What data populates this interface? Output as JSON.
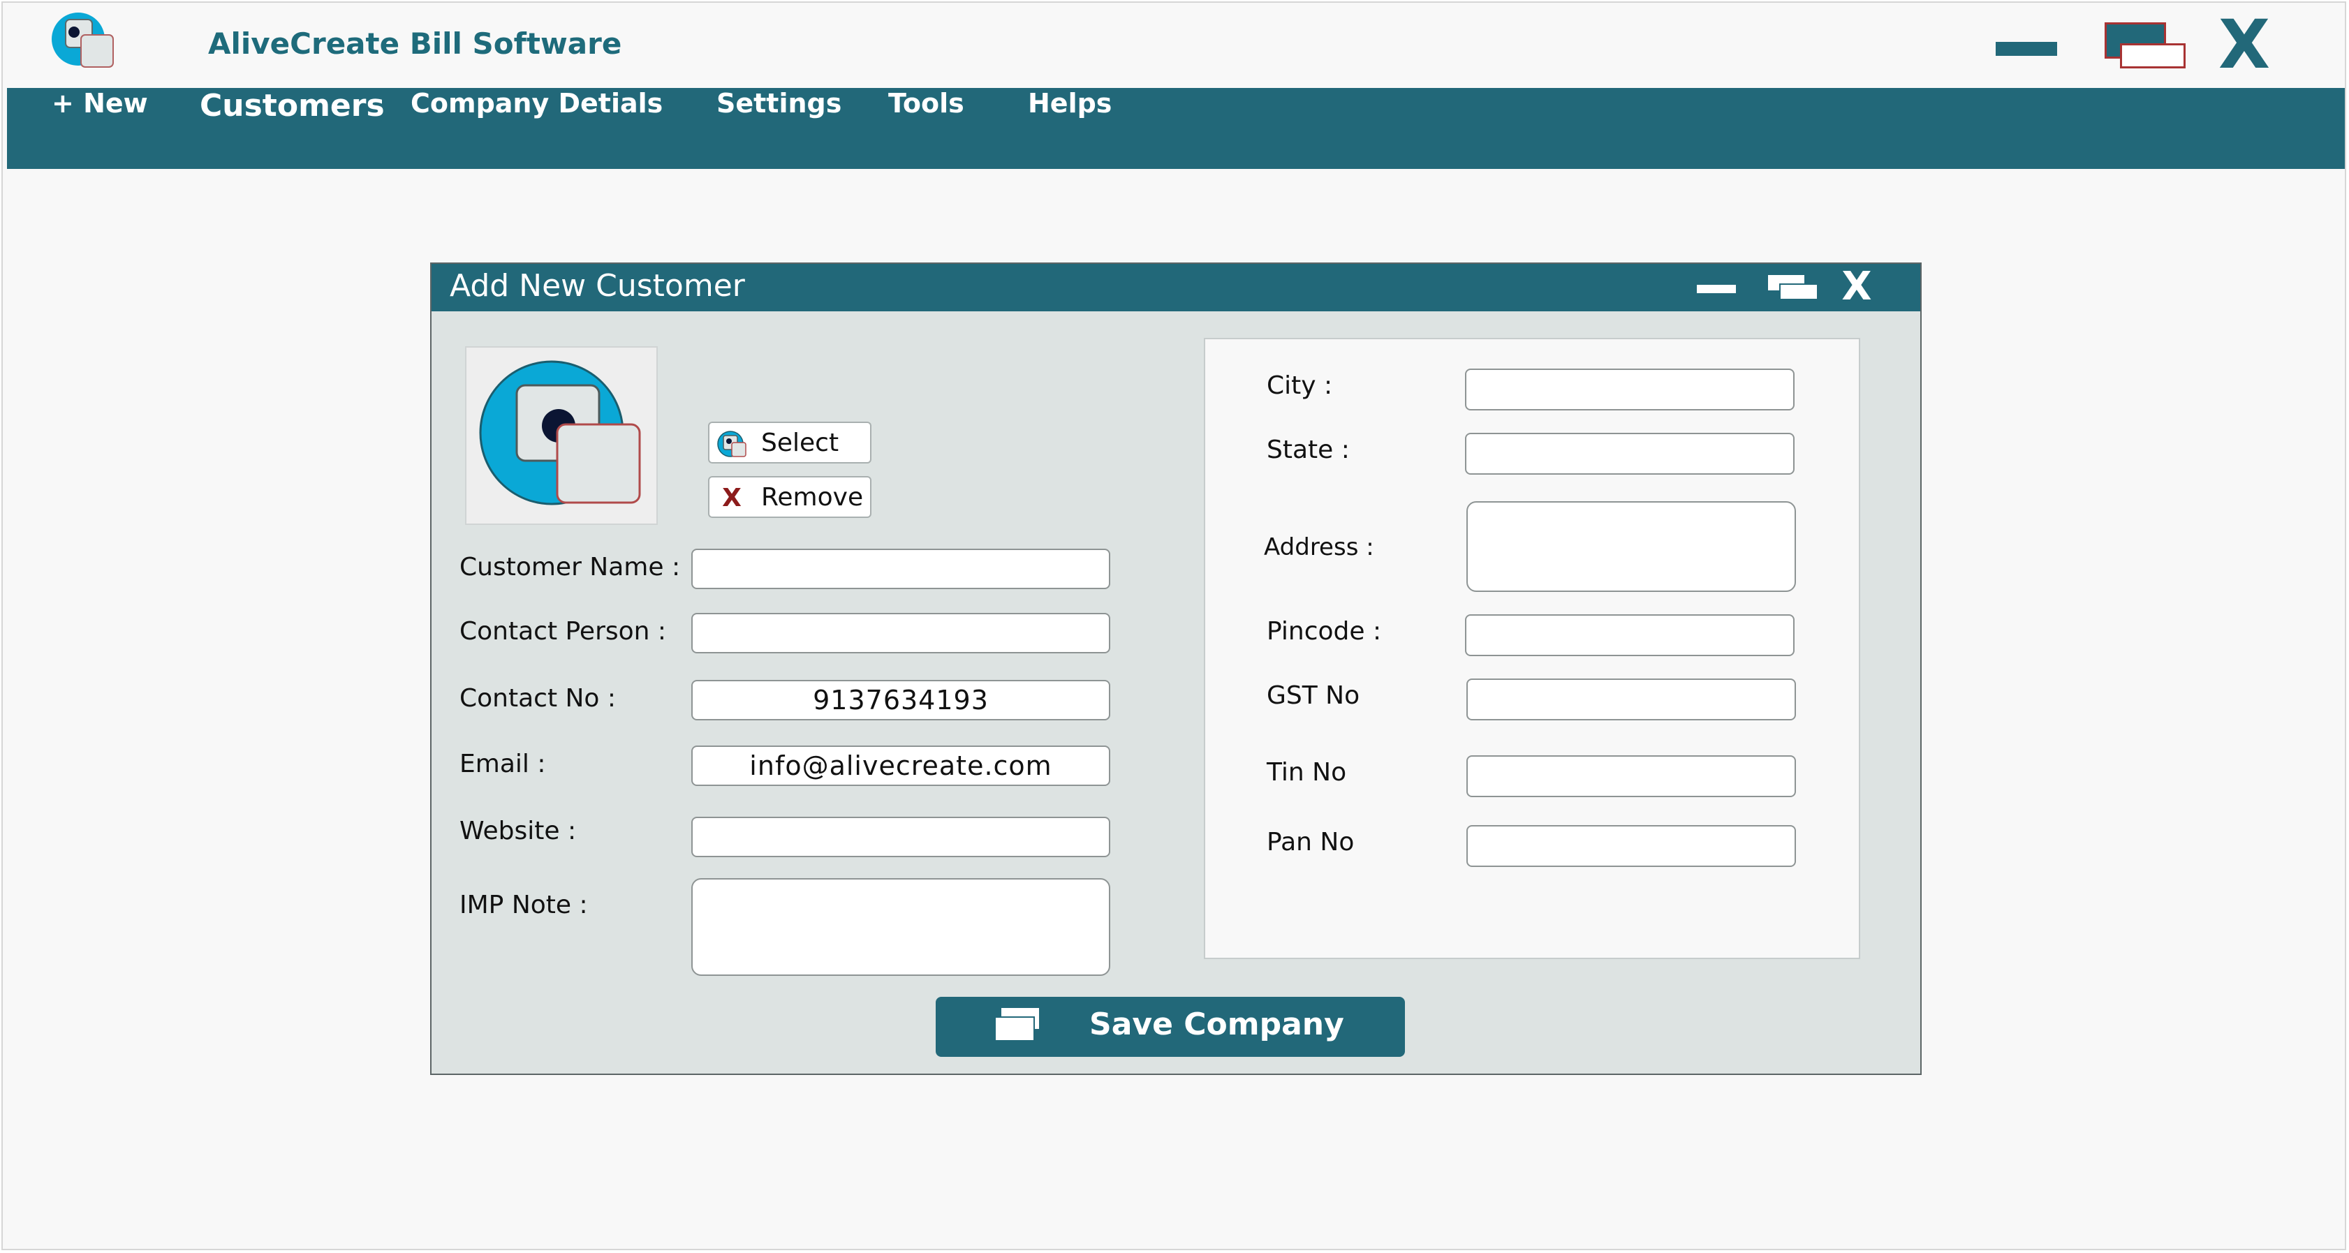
{
  "app": {
    "title": "AliveCreate Bill Software",
    "accent": "#226879",
    "logo_icon": "app-logo-icon"
  },
  "window_controls": {
    "minimize_icon": "minimize-icon",
    "maximize_icon": "maximize-icon",
    "close_label": "X"
  },
  "menu": {
    "new": "+ New",
    "customers": "Customers",
    "company_details": "Company Detials",
    "settings": "Settings",
    "tools": "Tools",
    "helps": "Helps"
  },
  "dialog": {
    "title": "Add New Customer",
    "close_label": "X",
    "select_label": "Select",
    "remove_label": "Remove",
    "remove_icon_label": "X",
    "save_label": "Save Company"
  },
  "left_fields": {
    "customer_name": {
      "label": "Customer Name :",
      "value": ""
    },
    "contact_person": {
      "label": "Contact Person :",
      "value": ""
    },
    "contact_no": {
      "label": "Contact No :",
      "value": "9137634193"
    },
    "email": {
      "label": "Email :",
      "value": "info@alivecreate.com"
    },
    "website": {
      "label": "Website :",
      "value": ""
    },
    "imp_note": {
      "label": "IMP Note :",
      "value": ""
    }
  },
  "right_fields": {
    "city": {
      "label": "City :",
      "value": ""
    },
    "state": {
      "label": "State :",
      "value": ""
    },
    "address": {
      "label": "Address :",
      "value": ""
    },
    "pincode": {
      "label": "Pincode :",
      "value": ""
    },
    "gst_no": {
      "label": "GST No",
      "value": ""
    },
    "tin_no": {
      "label": "Tin No",
      "value": ""
    },
    "pan_no": {
      "label": "Pan No",
      "value": ""
    }
  }
}
